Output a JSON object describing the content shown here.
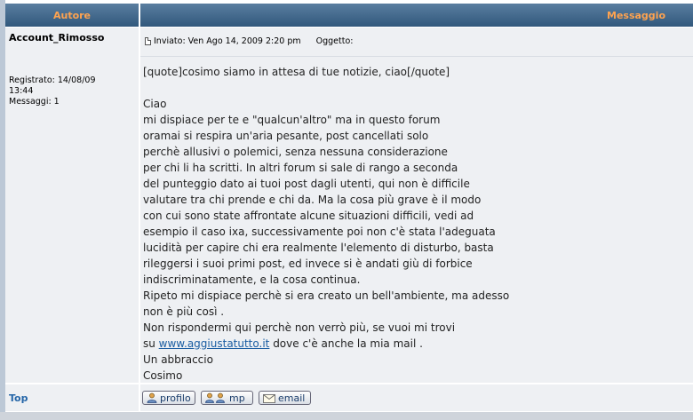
{
  "header": {
    "author_label": "Autore",
    "message_label": "Messaggio"
  },
  "author": {
    "username": "Account_Rimosso",
    "registered_line1": "Registrato: 14/08/09",
    "registered_line2": "13:44",
    "messages": "Messaggi: 1"
  },
  "post": {
    "meta": "Inviato: Ven Ago 14, 2009 2:20 pm",
    "subject_label": "Oggetto:",
    "quote": "[quote]cosimo siamo in attesa di tue notizie, ciao[/quote]",
    "lines_before_link": [
      "Ciao",
      "mi dispiace per te e \"qualcun'altro\" ma in questo forum",
      "oramai si respira un'aria pesante, post cancellati solo",
      "perchè allusivi o polemici, senza nessuna considerazione",
      "per chi li ha scritti. In altri forum si sale di rango a seconda",
      "del punteggio dato ai tuoi post dagli utenti, qui non è difficile",
      "valutare tra chi prende e chi da. Ma la cosa più grave è il modo",
      "con cui sono state affrontate alcune situazioni difficili, vedi ad",
      "esempio il caso ixa, successivamente poi non c'è stata l'adeguata",
      "lucidità per capire chi era realmente l'elemento di disturbo, basta",
      "rileggersi i suoi primi post, ed invece si è andati giù di forbice",
      "indiscriminatamente, e la cosa continua.",
      "Ripeto mi dispiace perchè si era creato un bell'ambiente, ma adesso",
      "non è più così .",
      "Non rispondermi qui perchè non verrò più, se vuoi mi trovi"
    ],
    "link_prefix": "su ",
    "link_text": "www.aggiustatutto.it",
    "link_suffix": " dove c'è anche la mia mail .",
    "closing_lines": [
      "Un abbraccio",
      "Cosimo"
    ]
  },
  "footer": {
    "top_label": "Top",
    "profile_label": "profilo",
    "pm_label": "mp",
    "email_label": "email"
  },
  "colors": {
    "header_text": "#ffa34f",
    "header_bg": "#31587c",
    "cell_bg": "#eef0f3",
    "link": "#1a5da2"
  },
  "icons": [
    "post-icon",
    "profile-icon",
    "pm-icon",
    "email-icon"
  ]
}
